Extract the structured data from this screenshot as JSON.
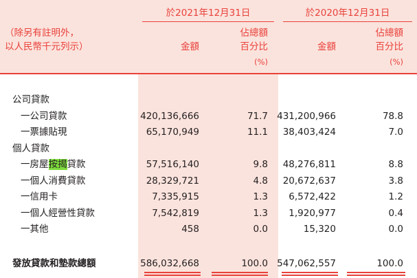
{
  "periods": [
    "於2021年12月31日",
    "於2020年12月31日"
  ],
  "note": [
    "（除另有註明外，",
    "以人民幣千元列示）"
  ],
  "columns": {
    "amount": "金額",
    "pct_line1": "佔總額",
    "pct_line2": "百分比",
    "pct_unit": "(%)"
  },
  "rows": [
    {
      "label": "公司貸款",
      "level": 0,
      "v": [
        "",
        "",
        "",
        ""
      ]
    },
    {
      "label": "一公司貸款",
      "level": 1,
      "v": [
        "420,136,666",
        "71.7",
        "431,200,966",
        "78.8"
      ]
    },
    {
      "label": "一票據貼現",
      "level": 1,
      "v": [
        "65,170,949",
        "11.1",
        "38,403,424",
        "7.0"
      ]
    },
    {
      "label": "個人貸款",
      "level": 0,
      "v": [
        "",
        "",
        "",
        ""
      ]
    },
    {
      "label": "一房屋按揭貸款",
      "level": 1,
      "v": [
        "57,516,140",
        "9.8",
        "48,276,811",
        "8.8"
      ],
      "highlight": "按揭"
    },
    {
      "label": "一個人消費貸款",
      "level": 1,
      "v": [
        "28,329,721",
        "4.8",
        "20,672,637",
        "3.8"
      ]
    },
    {
      "label": "一信用卡",
      "level": 1,
      "v": [
        "7,335,915",
        "1.3",
        "6,572,422",
        "1.2"
      ]
    },
    {
      "label": "一個人經營性貸款",
      "level": 1,
      "v": [
        "7,542,819",
        "1.3",
        "1,920,977",
        "0.4"
      ]
    },
    {
      "label": "一其他",
      "level": 1,
      "v": [
        "458",
        "0.0",
        "15,320",
        "0.0"
      ]
    }
  ],
  "total": {
    "label": "發放貸款和墊款總額",
    "v": [
      "586,032,668",
      "100.0",
      "547,062,557",
      "100.0"
    ]
  },
  "colors": {
    "accent": "#e8413a",
    "band": "#fbe3dd",
    "highlight": "#7ddb3c",
    "text": "#231f20"
  }
}
